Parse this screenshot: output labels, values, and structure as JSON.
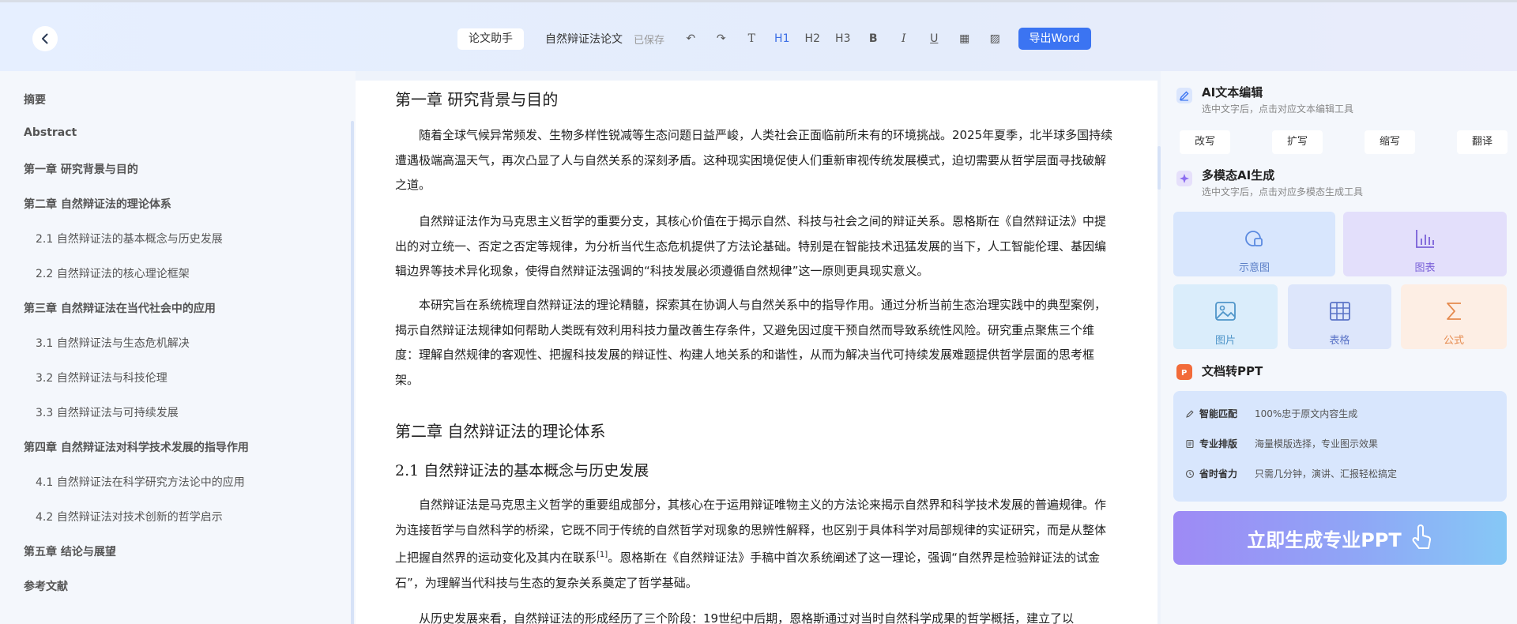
{
  "header": {
    "assistant_label": "论文助手",
    "doc_title": "自然辩证法论文",
    "saved_status": "已保存",
    "tools": [
      {
        "name": "undo-button",
        "glyph": "↶"
      },
      {
        "name": "redo-button",
        "glyph": "↷"
      },
      {
        "name": "text-button",
        "glyph": "T"
      },
      {
        "name": "h1-button",
        "glyph": "H1"
      },
      {
        "name": "h2-button",
        "glyph": "H2"
      },
      {
        "name": "h3-button",
        "glyph": "H3"
      },
      {
        "name": "bold-button",
        "glyph": "B"
      },
      {
        "name": "italic-button",
        "glyph": "I"
      },
      {
        "name": "underline-button",
        "glyph": "U"
      },
      {
        "name": "table-button",
        "glyph": "▦"
      },
      {
        "name": "image-button",
        "glyph": "▨"
      }
    ],
    "export_label": "导出Word"
  },
  "toc": [
    {
      "label": "摘要",
      "level": 1
    },
    {
      "label": "Abstract",
      "level": 1
    },
    {
      "label": "第一章 研究背景与目的",
      "level": 1
    },
    {
      "label": "第二章 自然辩证法的理论体系",
      "level": 1
    },
    {
      "label": "2.1 自然辩证法的基本概念与历史发展",
      "level": 2
    },
    {
      "label": "2.2 自然辩证法的核心理论框架",
      "level": 2
    },
    {
      "label": "第三章 自然辩证法在当代社会中的应用",
      "level": 1
    },
    {
      "label": "3.1 自然辩证法与生态危机解决",
      "level": 2
    },
    {
      "label": "3.2 自然辩证法与科技伦理",
      "level": 2
    },
    {
      "label": "3.3 自然辩证法与可持续发展",
      "level": 2
    },
    {
      "label": "第四章 自然辩证法对科学技术发展的指导作用",
      "level": 1
    },
    {
      "label": "4.1 自然辩证法在科学研究方法论中的应用",
      "level": 2
    },
    {
      "label": "4.2 自然辩证法对技术创新的哲学启示",
      "level": 2
    },
    {
      "label": "第五章 结论与展望",
      "level": 1
    },
    {
      "label": "参考文献",
      "level": 1
    }
  ],
  "doc": {
    "ch1_title": "第一章 研究背景与目的",
    "p1": "随着全球气候异常频发、生物多样性锐减等生态问题日益严峻，人类社会正面临前所未有的环境挑战。2025年夏季，北半球多国持续遭遇极端高温天气，再次凸显了人与自然关系的深刻矛盾。这种现实困境促使人们重新审视传统发展模式，迫切需要从哲学层面寻找破解之道。",
    "p2": "自然辩证法作为马克思主义哲学的重要分支，其核心价值在于揭示自然、科技与社会之间的辩证关系。恩格斯在《自然辩证法》中提出的对立统一、否定之否定等规律，为分析当代生态危机提供了方法论基础。特别是在智能技术迅猛发展的当下，人工智能伦理、基因编辑边界等技术异化现象，使得自然辩证法强调的“科技发展必须遵循自然规律”这一原则更具现实意义。",
    "p3": "本研究旨在系统梳理自然辩证法的理论精髓，探索其在协调人与自然关系中的指导作用。通过分析当前生态治理实践中的典型案例，揭示自然辩证法规律如何帮助人类既有效利用科技力量改善生存条件，又避免因过度干预自然而导致系统性风险。研究重点聚焦三个维度：理解自然规律的客观性、把握科技发展的辩证性、构建人地关系的和谐性，从而为解决当代可持续发展难题提供哲学层面的思考框架。",
    "ch2_title": "第二章 自然辩证法的理论体系",
    "s21_title": "2.1 自然辩证法的基本概念与历史发展",
    "p4a": "自然辩证法是马克思主义哲学的重要组成部分，其核心在于运用辩证唯物主义的方法论来揭示自然界和科学技术发展的普遍规律。作为连接哲学与自然科学的桥梁，它既不同于传统的自然哲学对现象的思辨性解释，也区别于具体科学对局部规律的实证研究，而是从整体上把握自然界的运动变化及其内在联系",
    "p4_ref": "[1]",
    "p4b": "。恩格斯在《自然辩证法》手稿中首次系统阐述了这一理论，强调“自然界是检验辩证法的试金石”，为理解当代科技与生态的复杂关系奠定了哲学基础。",
    "p5": "从历史发展来看，自然辩证法的形成经历了三个阶段：19世纪中后期，恩格斯通过对当时自然科学成果的哲学概括，建立了以"
  },
  "panel": {
    "ai_edit_title": "AI文本编辑",
    "ai_edit_sub": "选中文字后，点击对应文本编辑工具",
    "edit_buttons": [
      "改写",
      "扩写",
      "缩写",
      "翻译"
    ],
    "multimodal_title": "多模态AI生成",
    "multimodal_sub": "选中文字后，点击对应多模态生成工具",
    "tiles": {
      "diagram": "示意图",
      "chart": "图表",
      "image": "图片",
      "table": "表格",
      "formula": "公式"
    },
    "ppt_title": "文档转PPT",
    "ppt_features": [
      {
        "key": "智能匹配",
        "value": "100%忠于原文内容生成"
      },
      {
        "key": "专业排版",
        "value": "海量模版选择，专业图示效果"
      },
      {
        "key": "省时省力",
        "value": "只需几分钟，演讲、汇报轻松搞定"
      }
    ],
    "generate_label": "立即生成专业PPT"
  },
  "colors": {
    "accent": "#3b74f2",
    "tile_blue": "#d8e6fd",
    "tile_purple": "#e3dffb",
    "tile_cyan": "#daedfb",
    "tile_orange": "#fdeee4"
  }
}
